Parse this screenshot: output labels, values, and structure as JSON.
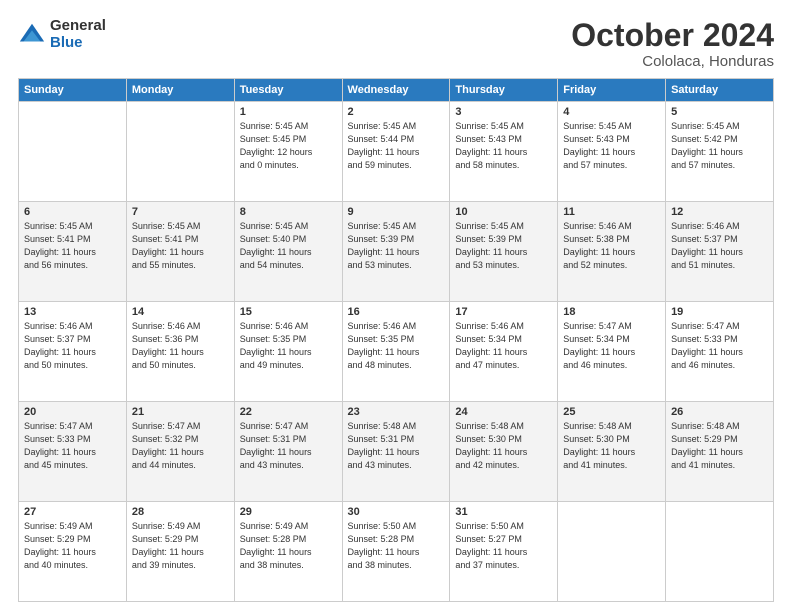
{
  "logo": {
    "general": "General",
    "blue": "Blue"
  },
  "header": {
    "month": "October 2024",
    "location": "Cololaca, Honduras"
  },
  "weekdays": [
    "Sunday",
    "Monday",
    "Tuesday",
    "Wednesday",
    "Thursday",
    "Friday",
    "Saturday"
  ],
  "weeks": [
    [
      {
        "day": "",
        "info": ""
      },
      {
        "day": "",
        "info": ""
      },
      {
        "day": "1",
        "info": "Sunrise: 5:45 AM\nSunset: 5:45 PM\nDaylight: 12 hours\nand 0 minutes."
      },
      {
        "day": "2",
        "info": "Sunrise: 5:45 AM\nSunset: 5:44 PM\nDaylight: 11 hours\nand 59 minutes."
      },
      {
        "day": "3",
        "info": "Sunrise: 5:45 AM\nSunset: 5:43 PM\nDaylight: 11 hours\nand 58 minutes."
      },
      {
        "day": "4",
        "info": "Sunrise: 5:45 AM\nSunset: 5:43 PM\nDaylight: 11 hours\nand 57 minutes."
      },
      {
        "day": "5",
        "info": "Sunrise: 5:45 AM\nSunset: 5:42 PM\nDaylight: 11 hours\nand 57 minutes."
      }
    ],
    [
      {
        "day": "6",
        "info": "Sunrise: 5:45 AM\nSunset: 5:41 PM\nDaylight: 11 hours\nand 56 minutes."
      },
      {
        "day": "7",
        "info": "Sunrise: 5:45 AM\nSunset: 5:41 PM\nDaylight: 11 hours\nand 55 minutes."
      },
      {
        "day": "8",
        "info": "Sunrise: 5:45 AM\nSunset: 5:40 PM\nDaylight: 11 hours\nand 54 minutes."
      },
      {
        "day": "9",
        "info": "Sunrise: 5:45 AM\nSunset: 5:39 PM\nDaylight: 11 hours\nand 53 minutes."
      },
      {
        "day": "10",
        "info": "Sunrise: 5:45 AM\nSunset: 5:39 PM\nDaylight: 11 hours\nand 53 minutes."
      },
      {
        "day": "11",
        "info": "Sunrise: 5:46 AM\nSunset: 5:38 PM\nDaylight: 11 hours\nand 52 minutes."
      },
      {
        "day": "12",
        "info": "Sunrise: 5:46 AM\nSunset: 5:37 PM\nDaylight: 11 hours\nand 51 minutes."
      }
    ],
    [
      {
        "day": "13",
        "info": "Sunrise: 5:46 AM\nSunset: 5:37 PM\nDaylight: 11 hours\nand 50 minutes."
      },
      {
        "day": "14",
        "info": "Sunrise: 5:46 AM\nSunset: 5:36 PM\nDaylight: 11 hours\nand 50 minutes."
      },
      {
        "day": "15",
        "info": "Sunrise: 5:46 AM\nSunset: 5:35 PM\nDaylight: 11 hours\nand 49 minutes."
      },
      {
        "day": "16",
        "info": "Sunrise: 5:46 AM\nSunset: 5:35 PM\nDaylight: 11 hours\nand 48 minutes."
      },
      {
        "day": "17",
        "info": "Sunrise: 5:46 AM\nSunset: 5:34 PM\nDaylight: 11 hours\nand 47 minutes."
      },
      {
        "day": "18",
        "info": "Sunrise: 5:47 AM\nSunset: 5:34 PM\nDaylight: 11 hours\nand 46 minutes."
      },
      {
        "day": "19",
        "info": "Sunrise: 5:47 AM\nSunset: 5:33 PM\nDaylight: 11 hours\nand 46 minutes."
      }
    ],
    [
      {
        "day": "20",
        "info": "Sunrise: 5:47 AM\nSunset: 5:33 PM\nDaylight: 11 hours\nand 45 minutes."
      },
      {
        "day": "21",
        "info": "Sunrise: 5:47 AM\nSunset: 5:32 PM\nDaylight: 11 hours\nand 44 minutes."
      },
      {
        "day": "22",
        "info": "Sunrise: 5:47 AM\nSunset: 5:31 PM\nDaylight: 11 hours\nand 43 minutes."
      },
      {
        "day": "23",
        "info": "Sunrise: 5:48 AM\nSunset: 5:31 PM\nDaylight: 11 hours\nand 43 minutes."
      },
      {
        "day": "24",
        "info": "Sunrise: 5:48 AM\nSunset: 5:30 PM\nDaylight: 11 hours\nand 42 minutes."
      },
      {
        "day": "25",
        "info": "Sunrise: 5:48 AM\nSunset: 5:30 PM\nDaylight: 11 hours\nand 41 minutes."
      },
      {
        "day": "26",
        "info": "Sunrise: 5:48 AM\nSunset: 5:29 PM\nDaylight: 11 hours\nand 41 minutes."
      }
    ],
    [
      {
        "day": "27",
        "info": "Sunrise: 5:49 AM\nSunset: 5:29 PM\nDaylight: 11 hours\nand 40 minutes."
      },
      {
        "day": "28",
        "info": "Sunrise: 5:49 AM\nSunset: 5:29 PM\nDaylight: 11 hours\nand 39 minutes."
      },
      {
        "day": "29",
        "info": "Sunrise: 5:49 AM\nSunset: 5:28 PM\nDaylight: 11 hours\nand 38 minutes."
      },
      {
        "day": "30",
        "info": "Sunrise: 5:50 AM\nSunset: 5:28 PM\nDaylight: 11 hours\nand 38 minutes."
      },
      {
        "day": "31",
        "info": "Sunrise: 5:50 AM\nSunset: 5:27 PM\nDaylight: 11 hours\nand 37 minutes."
      },
      {
        "day": "",
        "info": ""
      },
      {
        "day": "",
        "info": ""
      }
    ]
  ]
}
